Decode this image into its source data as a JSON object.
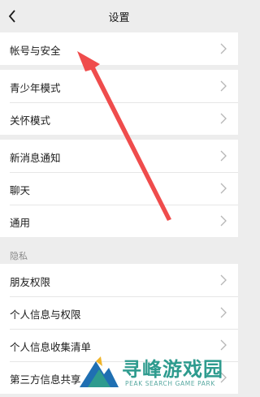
{
  "header": {
    "title": "设置"
  },
  "groups": [
    {
      "items": [
        {
          "label": "帐号与安全"
        }
      ]
    },
    {
      "items": [
        {
          "label": "青少年模式"
        },
        {
          "label": "关怀模式"
        }
      ]
    },
    {
      "items": [
        {
          "label": "新消息通知"
        },
        {
          "label": "聊天"
        },
        {
          "label": "通用"
        }
      ]
    },
    {
      "items": [
        {
          "label": "朋友权限"
        },
        {
          "label": "个人信息与权限"
        },
        {
          "label": "个人信息收集清单"
        },
        {
          "label": "第三方信息共享"
        }
      ]
    }
  ],
  "privacy_section": {
    "label": "隐私"
  },
  "annotation": {
    "arrow_color": "#ef4c4c"
  },
  "watermark": {
    "title": "寻峰游戏园",
    "subtitle": "PEAK SEARCH GAME PARK",
    "color": "#2e9b8e"
  },
  "icons": {
    "back": "chevron-left-icon",
    "row": "chevron-right-icon"
  }
}
